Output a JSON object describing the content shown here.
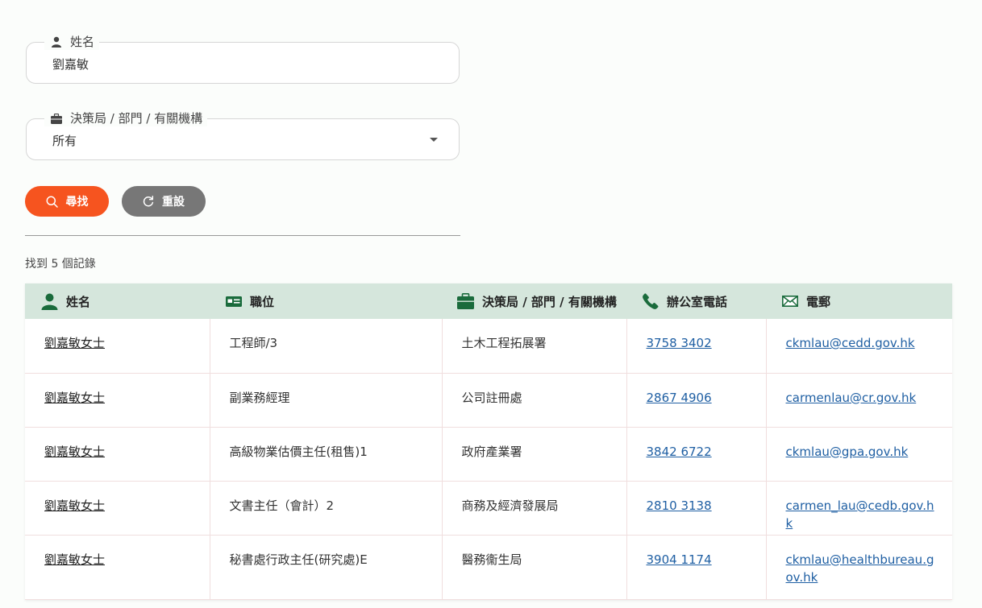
{
  "form": {
    "name_label": "姓名",
    "name_value": "劉嘉敏",
    "dept_label": "決策局 / 部門 / 有關機構",
    "dept_value": "所有",
    "search_label": "尋找",
    "reset_label": "重設"
  },
  "results": {
    "count_text": "找到 5 個記錄",
    "headers": {
      "name": "姓名",
      "post": "職位",
      "dept": "決策局 / 部門 / 有關機構",
      "phone": "辦公室電話",
      "email": "電郵"
    },
    "rows": [
      {
        "name": "劉嘉敏女士",
        "post": "工程師/3",
        "dept": "土木工程拓展署",
        "phone": "3758 3402",
        "email": "ckmlau@cedd.gov.hk"
      },
      {
        "name": "劉嘉敏女士",
        "post": "副業務經理",
        "dept": "公司註冊處",
        "phone": "2867 4906",
        "email": "carmenlau@cr.gov.hk"
      },
      {
        "name": "劉嘉敏女士",
        "post": "高級物業估價主任(租售)1",
        "dept": "政府產業署",
        "phone": "3842 6722",
        "email": "ckmlau@gpa.gov.hk"
      },
      {
        "name": "劉嘉敏女士",
        "post": "文書主任（會計）2",
        "dept": "商務及經濟發展局",
        "phone": "2810 3138",
        "email": "carmen_lau@cedb.gov.hk"
      },
      {
        "name": "劉嘉敏女士",
        "post": "秘書處行政主任(研究處)E",
        "dept": "醫務衞生局",
        "phone": "3904 1174",
        "email": "ckmlau@healthbureau.gov.hk"
      }
    ]
  },
  "colors": {
    "accent": "#f6541f",
    "reset": "#777777",
    "header_bg": "#d5e6dc",
    "icon_green": "#1a6b3c",
    "link_blue": "#1f5fa3"
  }
}
